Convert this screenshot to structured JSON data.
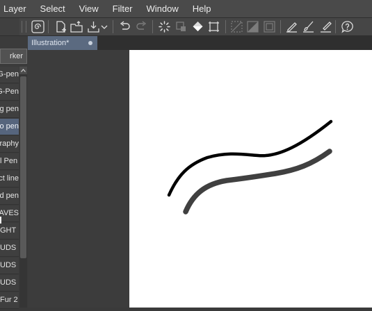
{
  "menu": {
    "items": [
      "Layer",
      "Select",
      "View",
      "Filter",
      "Window",
      "Help"
    ]
  },
  "toolbar": {
    "icons": [
      "spiral-icon",
      "new-file-icon",
      "open-file-icon",
      "export-icon",
      "undo-icon",
      "redo-icon",
      "loading-icon",
      "clear-icon",
      "fill-icon",
      "crop-icon",
      "selection-icon",
      "mask-icon",
      "frame-icon",
      "pen-ruler-icon",
      "brush-icon",
      "eraser-icon",
      "help-icon"
    ]
  },
  "tab": {
    "title": "Illustration*"
  },
  "panel": {
    "group_label": "rker",
    "brushes": [
      {
        "label": "G-pen",
        "selected": false
      },
      {
        "label": "G-Pen",
        "selected": false
      },
      {
        "label": "ng pen",
        "selected": false
      },
      {
        "label": "po pen",
        "selected": true
      },
      {
        "label": "graphy",
        "selected": false
      },
      {
        "label": "l Pen",
        "selected": false
      },
      {
        "label": "ct line",
        "selected": false
      },
      {
        "label": "d pen",
        "selected": false
      },
      {
        "label": "AVES",
        "selected": false
      },
      {
        "label": "GHT",
        "selected": false
      },
      {
        "label": "UDS",
        "selected": false
      },
      {
        "label": "UDS",
        "selected": false
      },
      {
        "label": "UDS",
        "selected": false
      },
      {
        "label": "Fur 2",
        "selected": false
      }
    ]
  },
  "colors": {
    "stroke_black": "#000000",
    "stroke_gray": "#404040",
    "canvas": "#ffffff",
    "selection": "#56657d"
  }
}
